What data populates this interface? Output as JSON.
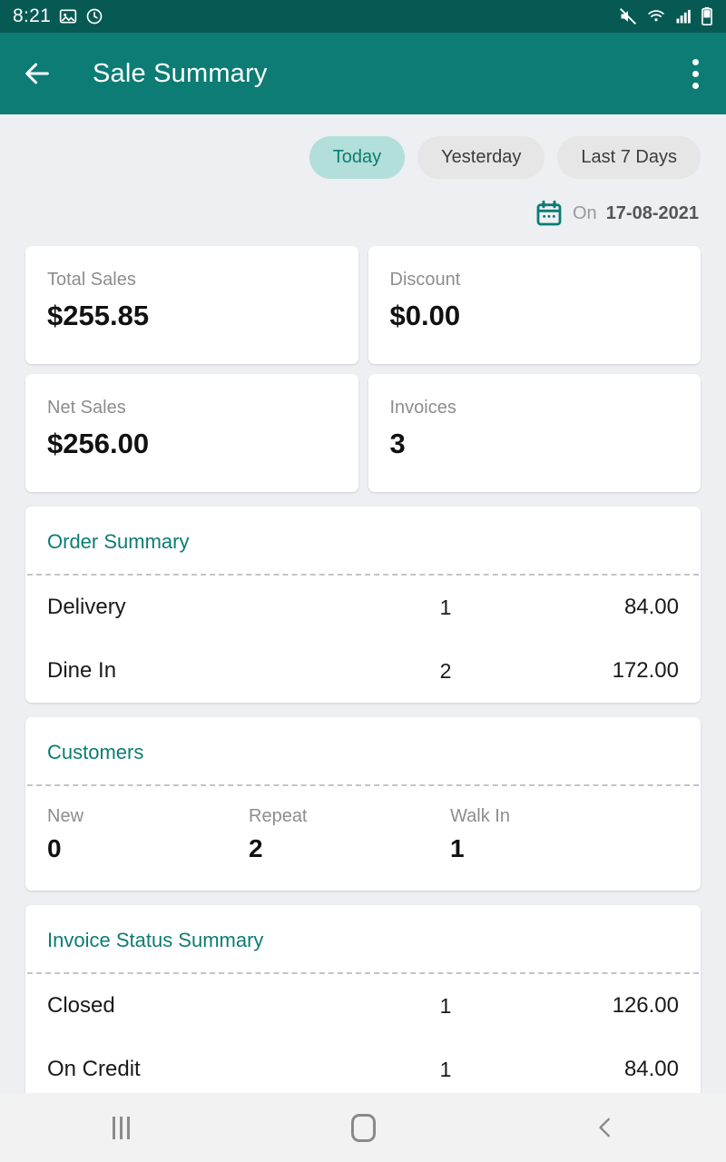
{
  "status_bar": {
    "time": "8:21",
    "icons_left": [
      "image-icon",
      "alarm-icon"
    ],
    "icons_right": [
      "mute-icon",
      "wifi-icon",
      "cellular-signal-icon",
      "battery-icon"
    ]
  },
  "app_bar": {
    "back_icon": "back-arrow-icon",
    "title": "Sale Summary",
    "overflow_icon": "overflow-menu-icon"
  },
  "filters": {
    "chips": [
      {
        "label": "Today",
        "selected": true
      },
      {
        "label": "Yesterday",
        "selected": false
      },
      {
        "label": "Last 7 Days",
        "selected": false
      }
    ]
  },
  "date_line": {
    "icon": "calendar-icon",
    "prefix": "On",
    "date": "17-08-2021"
  },
  "stats": [
    {
      "label": "Total Sales",
      "value": "$255.85"
    },
    {
      "label": "Discount",
      "value": "$0.00"
    },
    {
      "label": "Net Sales",
      "value": "$256.00"
    },
    {
      "label": "Invoices",
      "value": "3"
    }
  ],
  "order_summary": {
    "title": "Order Summary",
    "rows": [
      {
        "name": "Delivery",
        "qty": "1",
        "amount": "84.00"
      },
      {
        "name": "Dine In",
        "qty": "2",
        "amount": "172.00"
      }
    ]
  },
  "customers": {
    "title": "Customers",
    "columns": [
      {
        "label": "New",
        "value": "0"
      },
      {
        "label": "Repeat",
        "value": "2"
      },
      {
        "label": "Walk In",
        "value": "1"
      }
    ]
  },
  "invoice_status_summary": {
    "title": "Invoice Status Summary",
    "rows": [
      {
        "name": "Closed",
        "qty": "1",
        "amount": "126.00"
      },
      {
        "name": "On Credit",
        "qty": "1",
        "amount": "84.00"
      }
    ]
  },
  "nav_bar": {
    "recents_label": "recents-icon",
    "home_label": "home-icon",
    "back_label": "back-icon"
  },
  "colors": {
    "status_bar": "#075a54",
    "app_bar": "#0c7c74",
    "accent": "#0c7c74",
    "chip_active_bg": "#b2dfd9",
    "chip_bg": "#e6e6e6",
    "page_bg": "#edeff2",
    "card_bg": "#ffffff"
  }
}
